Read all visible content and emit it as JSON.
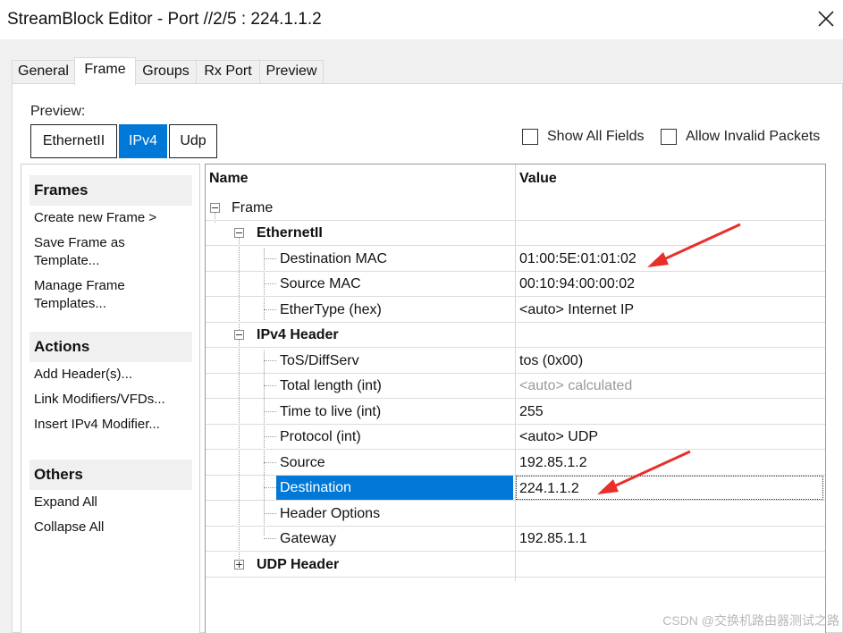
{
  "window": {
    "title": "StreamBlock Editor - Port //2/5 : 224.1.1.2",
    "close_icon": "close-icon"
  },
  "tabs": [
    "General",
    "Frame",
    "Groups",
    "Rx Port",
    "Preview"
  ],
  "active_tab": "Frame",
  "preview": {
    "label": "Preview:",
    "buttons": [
      "EthernetII",
      "IPv4",
      "Udp"
    ],
    "selected": "IPv4"
  },
  "options": {
    "show_all_fields": "Show All Fields",
    "allow_invalid_packets": "Allow Invalid Packets"
  },
  "sidebar": {
    "frames": {
      "title": "Frames",
      "items": [
        "Create new Frame >",
        "Save Frame as Template...",
        "Manage Frame Templates..."
      ]
    },
    "actions": {
      "title": "Actions",
      "items": [
        "Add Header(s)...",
        "Link Modifiers/VFDs...",
        "Insert IPv4 Modifier..."
      ]
    },
    "others": {
      "title": "Others",
      "items": [
        "Expand All",
        "Collapse All"
      ]
    }
  },
  "grid": {
    "col_name": "Name",
    "col_value": "Value",
    "rows": [
      {
        "name": "Frame",
        "value": ""
      },
      {
        "name": "EthernetII",
        "value": ""
      },
      {
        "name": "Destination MAC",
        "value": "01:00:5E:01:01:02"
      },
      {
        "name": "Source MAC",
        "value": "00:10:94:00:00:02"
      },
      {
        "name": "EtherType (hex)",
        "value": "<auto> Internet IP"
      },
      {
        "name": "IPv4 Header",
        "value": ""
      },
      {
        "name": "ToS/DiffServ",
        "value": "tos (0x00)"
      },
      {
        "name": "Total length (int)",
        "value": "<auto> calculated"
      },
      {
        "name": "Time to live (int)",
        "value": "255"
      },
      {
        "name": "Protocol (int)",
        "value": "<auto> UDP"
      },
      {
        "name": "Source",
        "value": "192.85.1.2"
      },
      {
        "name": "Destination",
        "value": "224.1.1.2"
      },
      {
        "name": "Header Options",
        "value": ""
      },
      {
        "name": "Gateway",
        "value": "192.85.1.1"
      },
      {
        "name": "UDP Header",
        "value": ""
      }
    ]
  },
  "annotation_color": "#e8302a",
  "selection_color": "#0078d7",
  "watermark": "CSDN @交换机路由器测试之路"
}
